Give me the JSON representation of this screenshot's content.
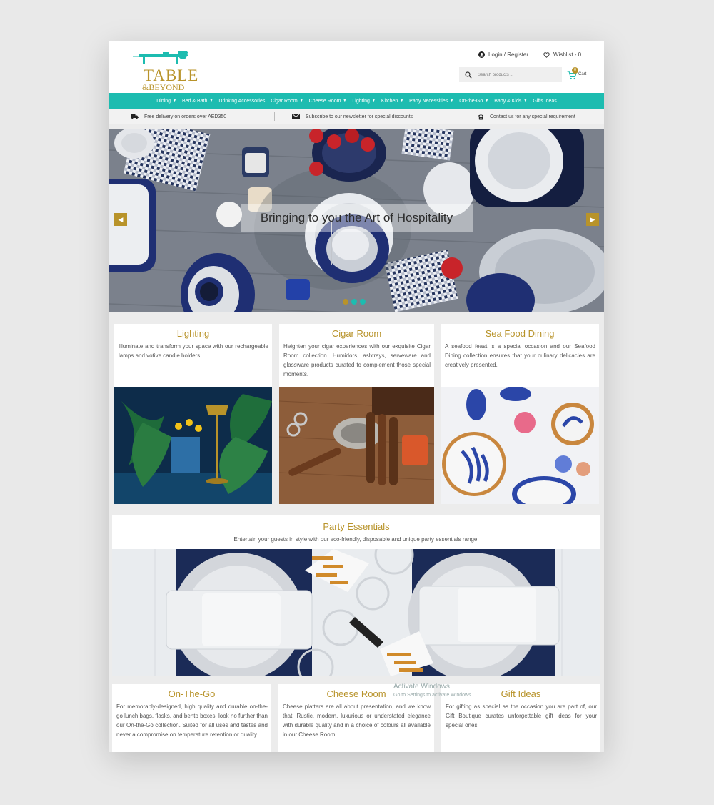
{
  "brand": {
    "line1": "TABLE",
    "line2": "&BEYOND"
  },
  "account": {
    "login_label": "Login / Register",
    "wishlist_label": "Wishlist - 0"
  },
  "search": {
    "placeholder": "Search products ..."
  },
  "cart": {
    "count": "0",
    "label": "Cart"
  },
  "nav": {
    "items": [
      {
        "label": "Dining",
        "has_caret": true
      },
      {
        "label": "Bed & Bath",
        "has_caret": true
      },
      {
        "label": "Drinking Accessories",
        "has_caret": false
      },
      {
        "label": "Cigar Room",
        "has_caret": true
      },
      {
        "label": "Cheese Room",
        "has_caret": true
      },
      {
        "label": "Lighting",
        "has_caret": true
      },
      {
        "label": "Kitchen",
        "has_caret": true
      },
      {
        "label": "Party Necessities",
        "has_caret": true
      },
      {
        "label": "On-the-Go",
        "has_caret": true
      },
      {
        "label": "Baby & Kids",
        "has_caret": true
      },
      {
        "label": "Gifts Ideas",
        "has_caret": false
      }
    ]
  },
  "infobar": {
    "delivery": "Free delivery on orders over AED350",
    "newsletter": "Subscribe to our newsletter for special discounts",
    "contact": "Contact us for any special requirement"
  },
  "hero": {
    "caption": "Bringing to you the Art of Hospitality",
    "active_slide": 1,
    "slide_count": 3
  },
  "categories": [
    {
      "title": "Lighting",
      "description": "Illuminate and transform your space with our rechargeable lamps and votive candle holders."
    },
    {
      "title": "Cigar Room",
      "description": "Heighten your cigar experiences with our exquisite Cigar Room collection. Humidors, ashtrays, serveware and glassware products curated to complement those special moments."
    },
    {
      "title": "Sea Food Dining",
      "description": "A seafood feast is a special occasion and our Seafood Dining collection ensures that your culinary delicacies are creatively presented."
    }
  ],
  "party": {
    "title": "Party Essentials",
    "description": "Entertain your guests in style with our eco-friendly, disposable and unique party essentials range."
  },
  "bottom_categories": [
    {
      "title": "On-The-Go",
      "description": "For memorably-designed, high quality and durable on-the-go lunch bags, flasks, and bento boxes, look no further than our On-the-Go collection. Suited for all uses and tastes and never a compromise on temperature retention or quality."
    },
    {
      "title": "Cheese Room",
      "description": "Cheese platters are all about presentation, and we know that! Rustic, modern, luxurious or understated elegance with durable quality and in a choice of colours all available in our Cheese Room."
    },
    {
      "title": "Gift Ideas",
      "description": "For gifting as special as the occasion you are part of, our Gift Boutique curates unforgettable gift ideas for your special ones."
    }
  ],
  "watermark": {
    "line1": "Activate Windows",
    "line2": "Go to Settings to activate Windows."
  },
  "colors": {
    "teal": "#1dbcb0",
    "gold": "#b8932a",
    "navy": "#1f2f73"
  }
}
